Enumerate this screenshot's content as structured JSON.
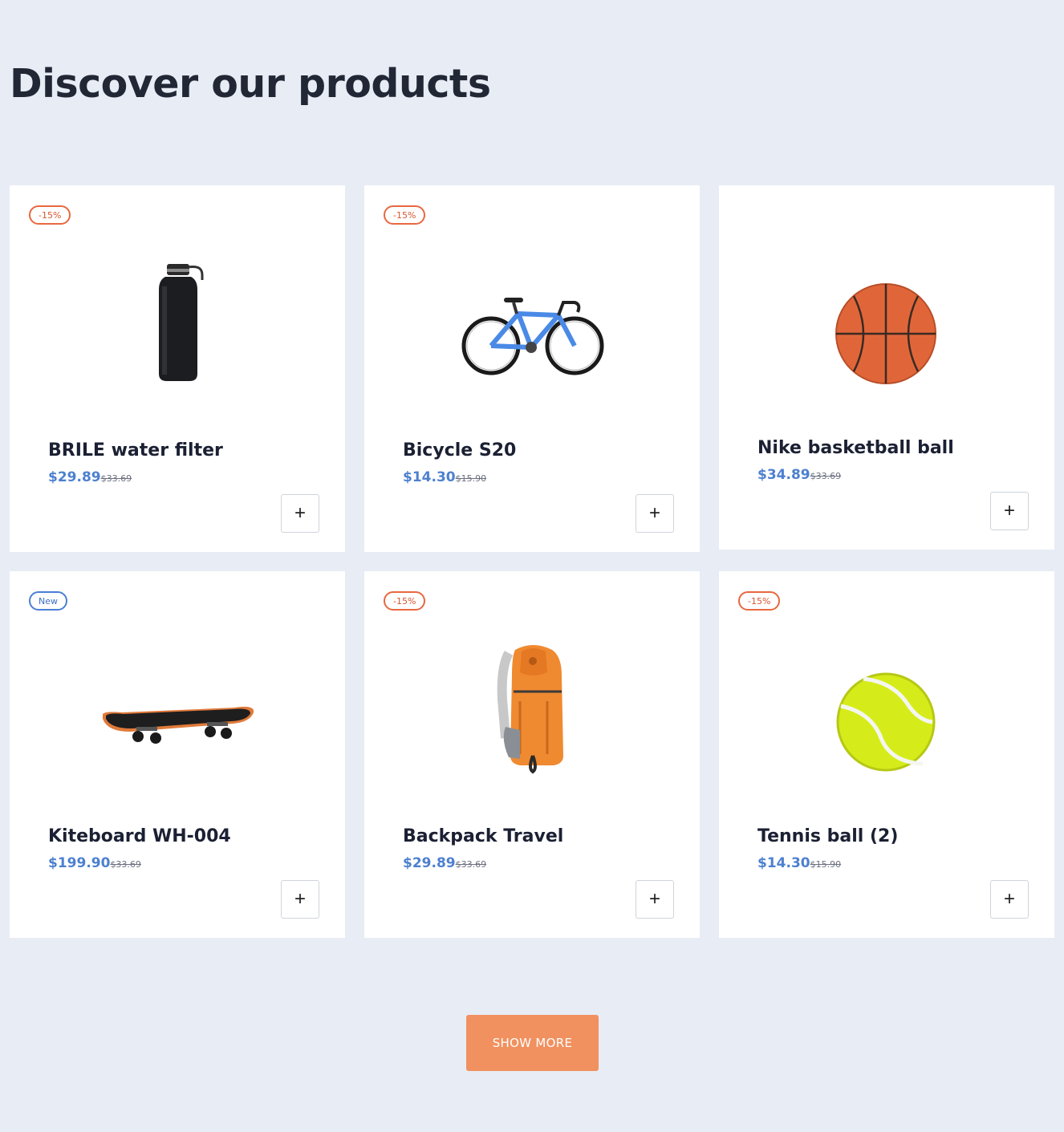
{
  "page": {
    "title": "Discover our products"
  },
  "products": [
    {
      "name": "BRILE water filter",
      "price": "$29.89",
      "old_price": "$33.69",
      "badge": "-15%",
      "badge_type": "sale",
      "image": "water-bottle-image",
      "add_label": "+"
    },
    {
      "name": "Bicycle S20",
      "price": "$14.30",
      "old_price": "$15.90",
      "badge": "-15%",
      "badge_type": "sale",
      "image": "bicycle-image",
      "add_label": "+"
    },
    {
      "name": "Nike basketball ball",
      "price": "$34.89",
      "old_price": "$33.69",
      "badge": "",
      "badge_type": "none",
      "image": "basketball-image",
      "add_label": "+"
    },
    {
      "name": "Kiteboard WH-004",
      "price": "$199.90",
      "old_price": "$33.69",
      "badge": "New",
      "badge_type": "new",
      "image": "skateboard-image",
      "add_label": "+"
    },
    {
      "name": "Backpack Travel",
      "price": "$29.89",
      "old_price": "$33.69",
      "badge": "-15%",
      "badge_type": "sale",
      "image": "backpack-image",
      "add_label": "+"
    },
    {
      "name": "Tennis ball (2)",
      "price": "$14.30",
      "old_price": "$15.90",
      "badge": "-15%",
      "badge_type": "sale",
      "image": "tennis-ball-image",
      "add_label": "+"
    }
  ],
  "show_more": {
    "label": "SHOW MORE"
  },
  "colors": {
    "background": "#e8ecf5",
    "price": "#4d80cf",
    "sale_badge": "#e8683f",
    "new_badge": "#4a7fd4",
    "cta": "#f1915f"
  }
}
